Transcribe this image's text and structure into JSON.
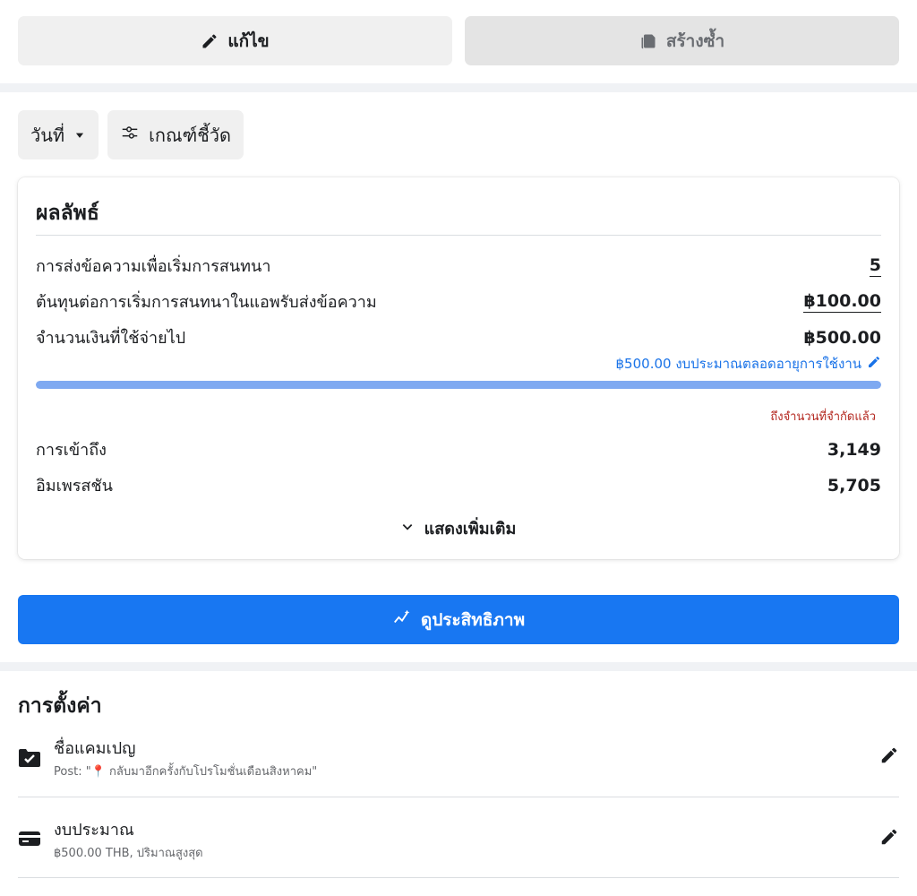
{
  "top_actions": {
    "edit_label": "แก้ไข",
    "duplicate_label": "สร้างซ้ำ"
  },
  "filters": {
    "date_label": "วันที่",
    "metrics_label": "เกณฑ์ชี้วัด"
  },
  "results": {
    "title": "ผลลัพธ์",
    "rows": [
      {
        "label": "การส่งข้อความเพื่อเริ่มการสนทนา",
        "value": "5"
      },
      {
        "label": "ต้นทุนต่อการเริ่มการสนทนาในแอพรับส่งข้อความ",
        "value": "฿100.00"
      },
      {
        "label": "จำนวนเงินที่ใช้จ่ายไป",
        "value": "฿500.00"
      }
    ],
    "budget_link": "฿500.00 งบประมาณตลอดอายุการใช้งาน",
    "progress_fraction": 1.0,
    "limit_note": "ถึงจำนวนที่จำกัดแล้ว",
    "extra_rows": [
      {
        "label": "การเข้าถึง",
        "value": "3,149"
      },
      {
        "label": "อิมเพรสชัน",
        "value": "5,705"
      }
    ],
    "show_more_label": "แสดงเพิ่มเติม"
  },
  "primary_button_label": "ดูประสิทธิภาพ",
  "settings": {
    "title": "การตั้งค่า",
    "items": [
      {
        "title": "ชื่อแคมเปญ",
        "subtitle": "Post: \"📍 กลับมาอีกครั้งกับโปรโมชั่นเดือนสิงหาคม\"",
        "icon": "folder-check-icon"
      },
      {
        "title": "งบประมาณ",
        "subtitle": "฿500.00 THB, ปริมาณสูงสุด",
        "icon": "credit-card-icon"
      }
    ]
  },
  "colors": {
    "primary": "#1877f2",
    "link": "#1a73e8",
    "progress": "#7ea9f1",
    "warning": "#b3261e"
  }
}
